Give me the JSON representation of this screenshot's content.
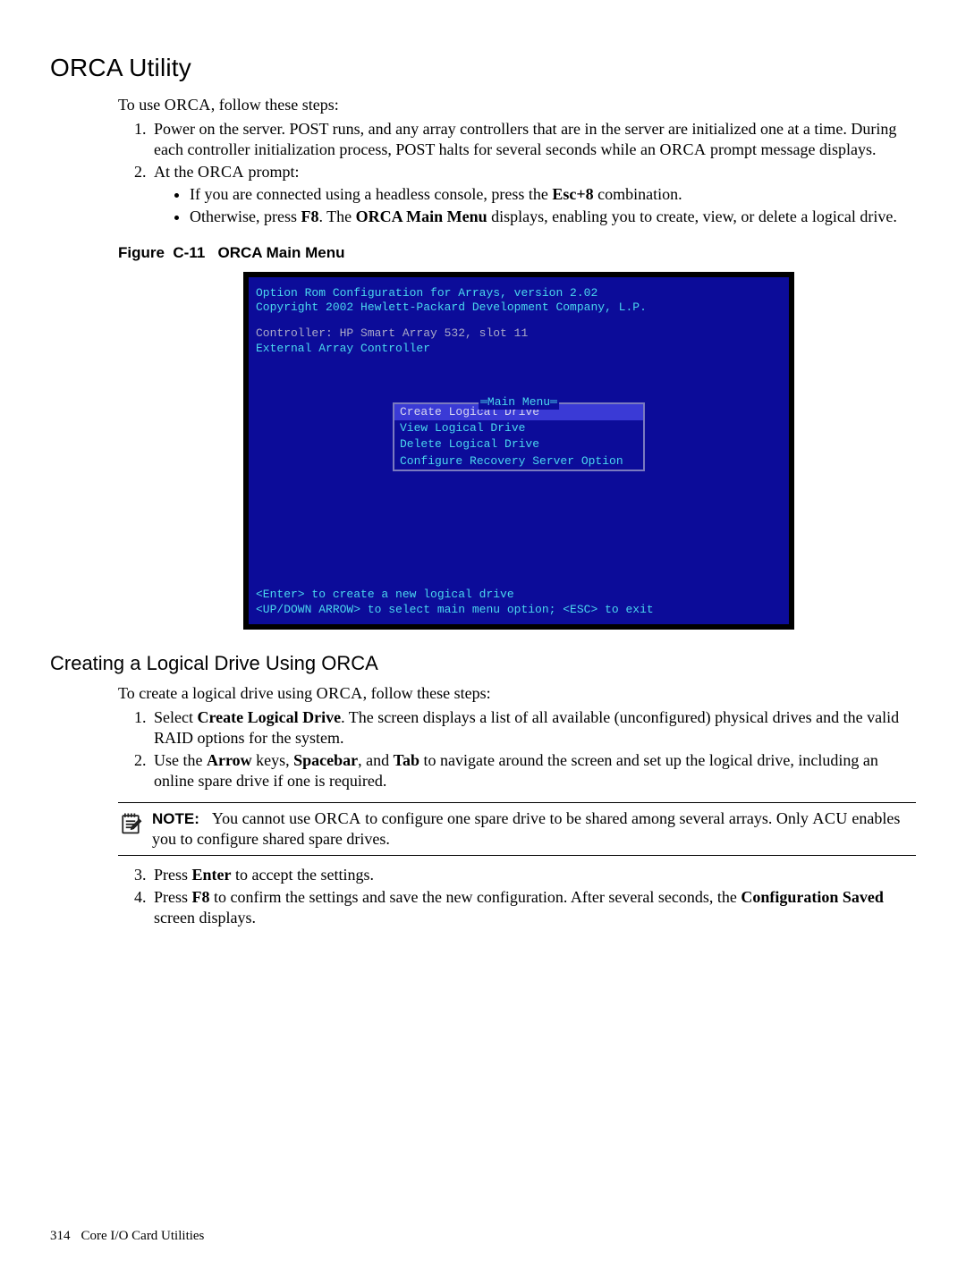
{
  "headings": {
    "h2": "ORCA Utility",
    "h3": "Creating a Logical Drive Using ORCA"
  },
  "intro": {
    "lead": "To use ",
    "orca": "ORCA",
    "tail": ", follow these steps:"
  },
  "steps1": {
    "s1": "Power on the server. POST runs, and any array controllers that are in the server are initialized one at a time. During each controller initialization process, POST halts for several seconds while an ",
    "s1_orca": "ORCA",
    "s1_tail": " prompt message displays.",
    "s2_lead": "At the ",
    "s2_orca": "ORCA",
    "s2_tail": " prompt:",
    "b1_lead": "If you are connected using a headless console, press the ",
    "b1_bold": "Esc+8",
    "b1_tail": " combination.",
    "b2_lead": "Otherwise, press ",
    "b2_bold1": "F8",
    "b2_mid": ". The ",
    "b2_bold2": "ORCA Main Menu",
    "b2_tail": " displays, enabling you to create, view, or delete a logical drive."
  },
  "figure": {
    "caption_label": "Figure  C-11",
    "caption_title": "ORCA Main Menu"
  },
  "crt": {
    "line1": "Option Rom Configuration for Arrays, version  2.02",
    "line2": "Copyright 2002 Hewlett-Packard Development Company, L.P.",
    "line3": "Controller: HP Smart Array 532, slot 11",
    "line4": "External Array Controller",
    "menu_title": "Main Menu",
    "menu_items": [
      "Create Logical Drive",
      "View Logical Drive",
      "Delete Logical Drive",
      "Configure Recovery Server Option"
    ],
    "footer1": "<Enter> to create a new logical drive",
    "footer2": "<UP/DOWN ARROW> to select main menu option; <ESC> to exit"
  },
  "section2": {
    "lead": "To create a logical drive using ",
    "orca": "ORCA",
    "tail": ", follow these steps:",
    "s1_lead": "Select ",
    "s1_bold": "Create Logical Drive",
    "s1_tail": ". The screen displays a list of all available (unconfigured) physical drives and the valid RAID options for the system.",
    "s2_lead": "Use the ",
    "s2_b1": "Arrow",
    "s2_m1": " keys, ",
    "s2_b2": "Spacebar",
    "s2_m2": ", and ",
    "s2_b3": "Tab",
    "s2_tail": " to navigate around the screen and set up the logical drive, including an online spare drive if one is required."
  },
  "note": {
    "label": "NOTE:",
    "t1": "You cannot use ",
    "orca": "ORCA",
    "t2": " to configure one spare drive to be shared among several arrays. Only ",
    "acu": "ACU",
    "t3": " enables you to configure shared spare drives."
  },
  "steps3": {
    "s3_lead": "Press ",
    "s3_bold": "Enter",
    "s3_tail": " to accept the settings.",
    "s4_lead": "Press ",
    "s4_bold1": "F8",
    "s4_mid": " to confirm the settings and save the new configuration. After several seconds, the ",
    "s4_bold2": "Configuration Saved",
    "s4_tail": " screen displays."
  },
  "footer": {
    "page": "314",
    "title": "Core I/O Card Utilities"
  }
}
